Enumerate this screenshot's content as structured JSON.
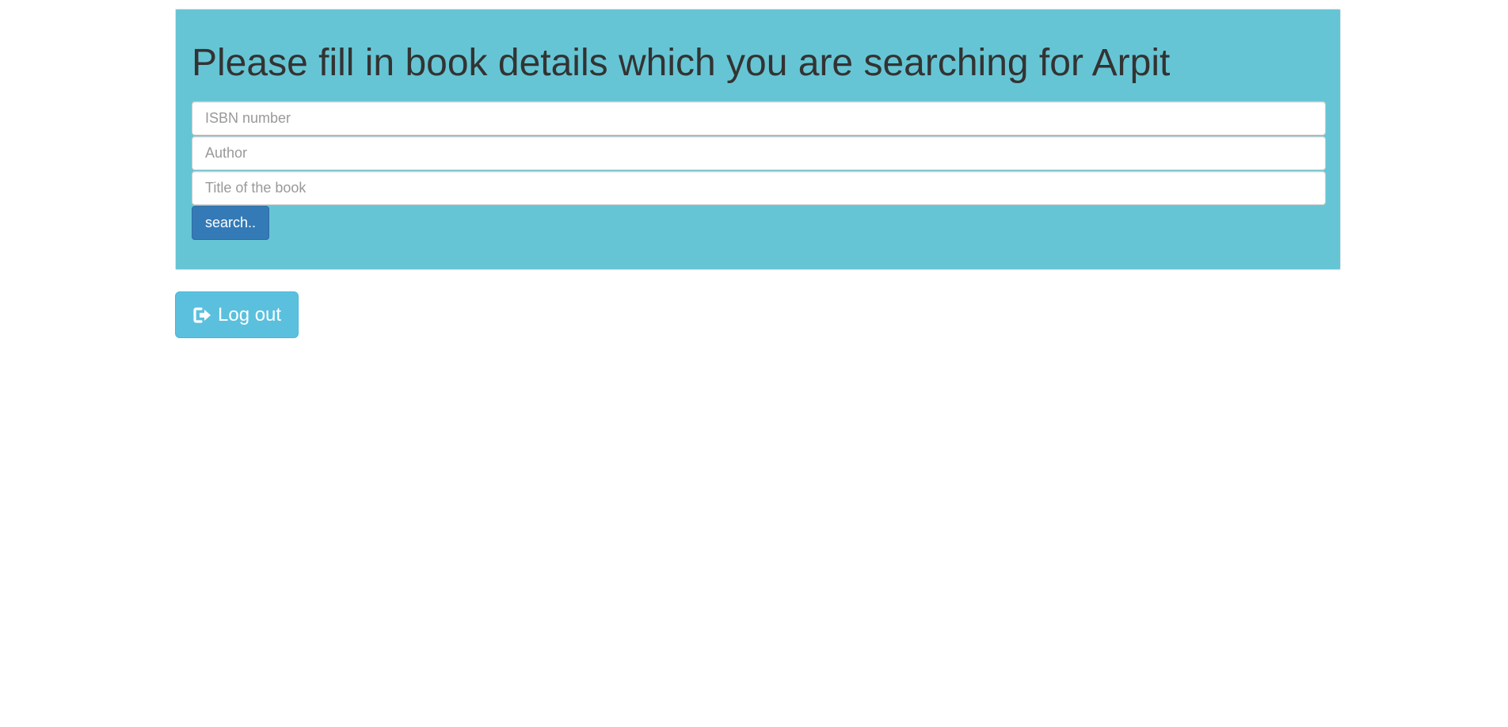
{
  "colors": {
    "panel_background": "#66c5d4",
    "search_button": "#337ab7",
    "logout_button": "#5bc0de"
  },
  "search_panel": {
    "heading": "Please fill in book details which you are searching for Arpit",
    "isbn_placeholder": "ISBN number",
    "author_placeholder": "Author",
    "title_placeholder": "Title of the book",
    "search_label": "search.."
  },
  "logout": {
    "icon": "log-out-icon",
    "label": "Log out"
  }
}
